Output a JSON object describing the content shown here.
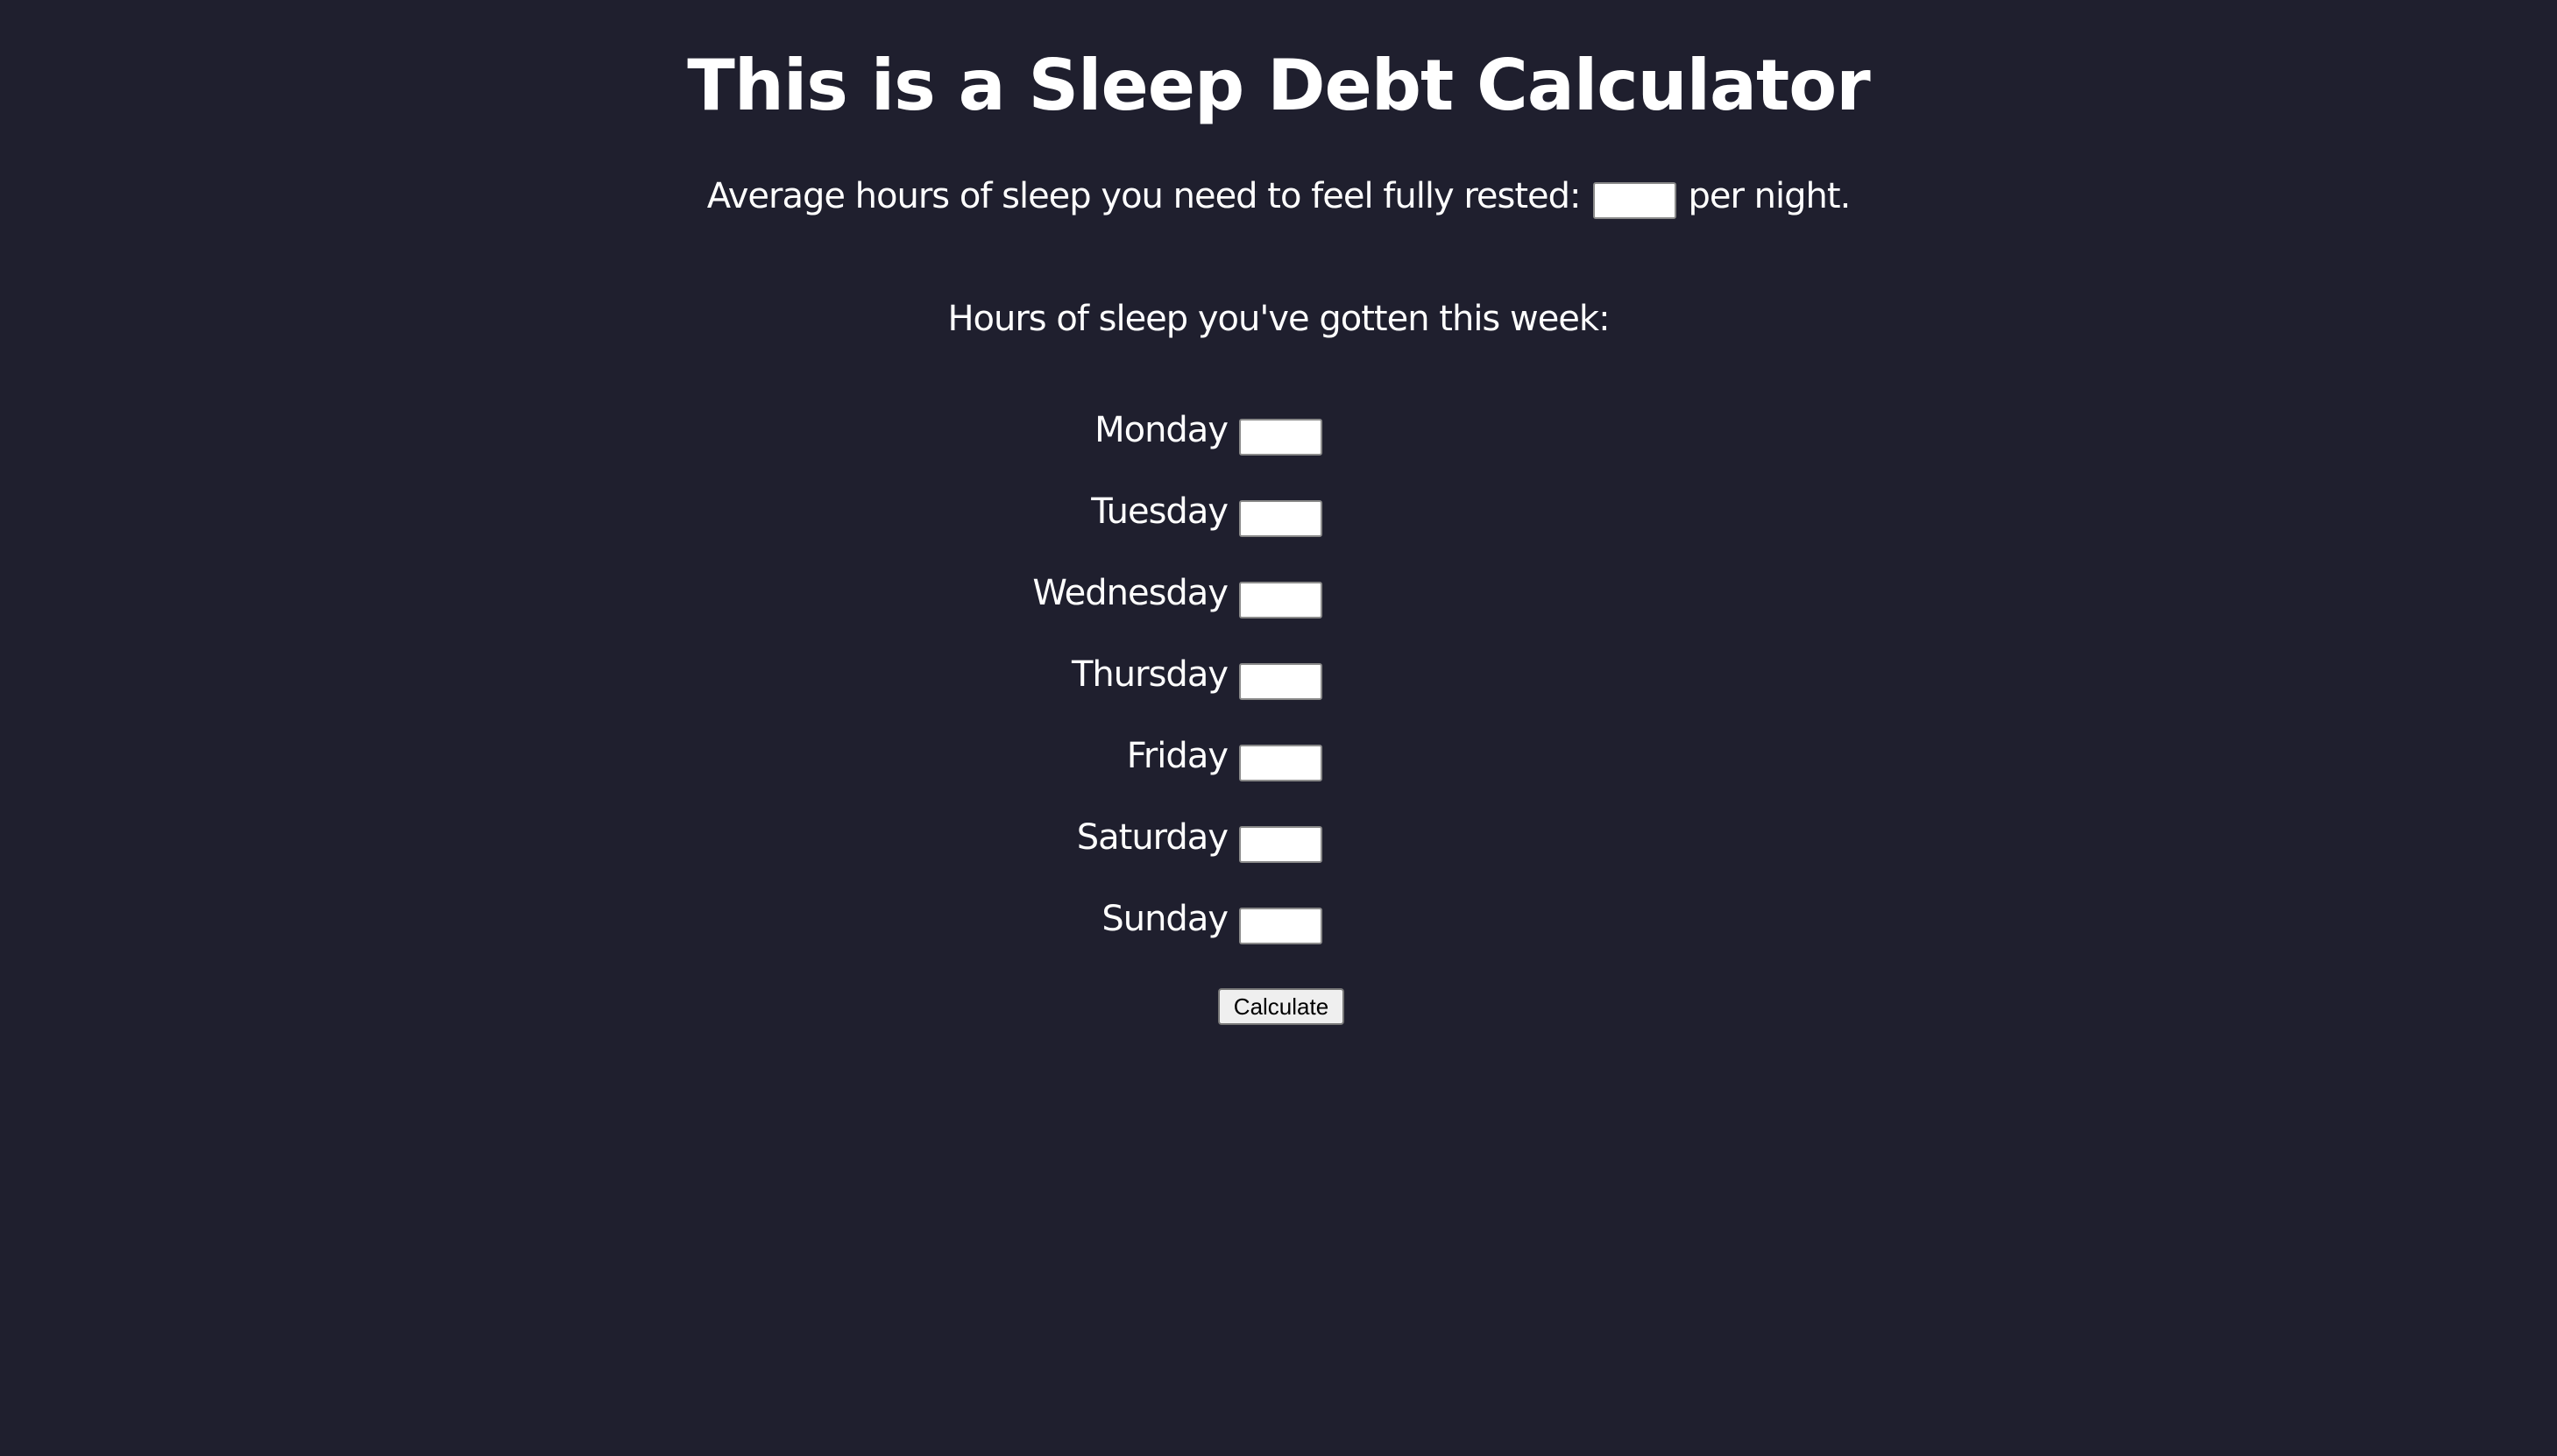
{
  "page": {
    "title": "This is a Sleep Debt Calculator",
    "background": "#1f1f2e"
  },
  "needed": {
    "label": "Average hours of sleep you need to feel fully rested:",
    "suffix": "per night.",
    "value": ""
  },
  "week": {
    "heading": "Hours of sleep you've gotten this week:",
    "days": [
      {
        "label": "Monday",
        "value": ""
      },
      {
        "label": "Tuesday",
        "value": ""
      },
      {
        "label": "Wednesday",
        "value": ""
      },
      {
        "label": "Thursday",
        "value": ""
      },
      {
        "label": "Friday",
        "value": ""
      },
      {
        "label": "Saturday",
        "value": ""
      },
      {
        "label": "Sunday",
        "value": ""
      }
    ]
  },
  "actions": {
    "calculate_label": "Calculate"
  }
}
